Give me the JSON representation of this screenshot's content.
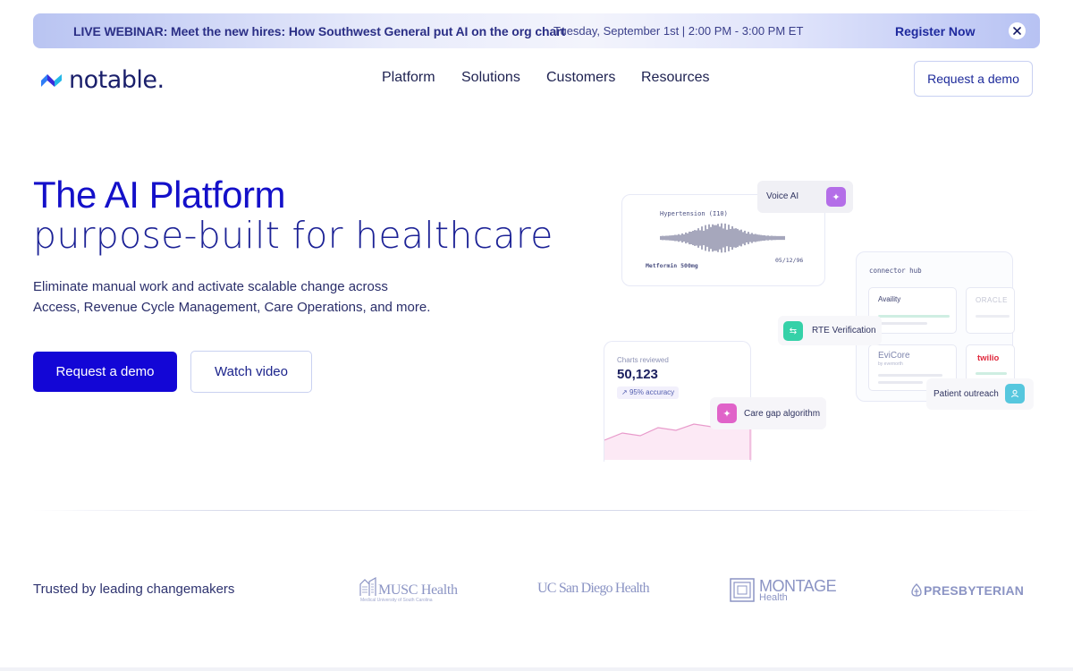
{
  "banner": {
    "title": "LIVE WEBINAR: Meet the new hires: How Southwest General put AI on the org chart",
    "date": "Tuesday, September 1st | 2:00 PM - 3:00 PM ET",
    "register": "Register Now",
    "close_icon": "close-icon"
  },
  "header": {
    "logo": "notable.",
    "nav": [
      "Platform",
      "Solutions",
      "Customers",
      "Resources"
    ],
    "demo_button": "Request a demo"
  },
  "hero": {
    "title_line1": "The AI Platform",
    "title_line2": "purpose-built for healthcare",
    "desc_line1": "Eliminate manual work and activate scalable change across",
    "desc_line2": "Access, Revenue Cycle Management, Care Operations, and more.",
    "primary_button": "Request a demo",
    "secondary_button": "Watch video"
  },
  "illustration": {
    "voice_ai": "Voice AI",
    "voice_card": {
      "diagnosis": "Hypertension (I10)",
      "medication": "Metformin 500mg",
      "date": "05/12/96"
    },
    "connector_hub": {
      "title": "connector hub",
      "partners": [
        "Availity",
        "ORACLE",
        "EviCore",
        "twilio"
      ],
      "evicore_sub": "by evernorth"
    },
    "rte": "RTE Verification",
    "charts": {
      "label": "Charts reviewed",
      "value": "50,123",
      "accuracy": "95% accuracy"
    },
    "care_gap": "Care gap algorithm",
    "patient_outreach": "Patient outreach",
    "colors": {
      "voice": "#b46ee8",
      "rte": "#35d1a8",
      "care": "#e063c9",
      "outreach": "#56c7de"
    }
  },
  "trusted": {
    "label": "Trusted by leading changemakers",
    "logos": {
      "musc": {
        "name": "MUSC Health",
        "sub": "Medical University of South Carolina"
      },
      "ucsd": "UC San Diego Health",
      "montage": {
        "name": "MONTAGE",
        "sub": "Health"
      },
      "presbyterian": "PRESBYTERIAN"
    }
  }
}
